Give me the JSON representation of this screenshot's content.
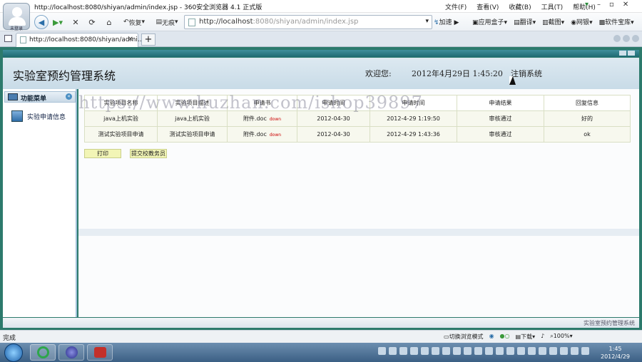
{
  "browser": {
    "window_title": "http://localhost:8080/shiyan/admin/index.jsp - 360安全浏览器 4.1 正式版",
    "avatar_label": "未登录",
    "menus": [
      "文件(F)",
      "查看(V)",
      "收藏(B)",
      "工具(T)",
      "帮助(H)"
    ],
    "nav": {
      "restore_label": "恢复",
      "nopic_label": "无痕"
    },
    "url_host": "http://localhost",
    "url_rest": ":8080/shiyan/admin/index.jsp",
    "accelerate_label": "加速",
    "toolbar": [
      "应用盒子",
      "翻译",
      "截图",
      "网银",
      "软件宝库"
    ],
    "tab_title": "http://localhost:8080/shiyan/admi..."
  },
  "app": {
    "system_name": "实验室预约管理系统",
    "welcome": "欢迎您:",
    "datetime": "2012年4月29日 1:45:20",
    "logout": "注销系统",
    "menu_header": "功能菜单",
    "menu_item": "实验申请信息",
    "footer_name": "实验室预约管理系统",
    "table": {
      "headers": [
        "实验项目名称",
        "实验项目描述",
        "申请书",
        "申请时间",
        "申请时间",
        "申请结果",
        "回复信息"
      ],
      "rows": [
        [
          "java上机实验",
          "java上机实验",
          "附件.doc",
          "down",
          "2012-04-30",
          "2012-4-29 1:19:50",
          "审核通过",
          "好的"
        ],
        [
          "测试实验项目申请",
          "测试实验项目申请",
          "附件.doc",
          "down",
          "2012-04-30",
          "2012-4-29 1:43:36",
          "审核通过",
          "ok"
        ]
      ]
    },
    "buttons": {
      "print": "打印",
      "submit": "提交校教务员"
    }
  },
  "watermark": "https://www.huzhan.com/ishop39897",
  "status": {
    "left": "完成",
    "switch_mode": "切换浏览模式",
    "download": "下载",
    "zoom": "100%"
  },
  "taskbar": {
    "time": "1:45",
    "date": "2012/4/29"
  }
}
